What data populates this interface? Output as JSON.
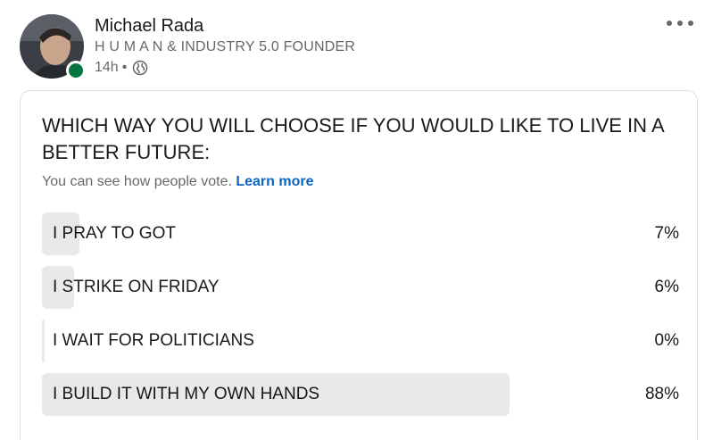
{
  "author": {
    "name": "Michael Rada",
    "headline": "H U M A N & INDUSTRY 5.0 FOUNDER",
    "time": "14h",
    "separator": "•",
    "status_color": "#057642"
  },
  "poll": {
    "question": "WHICH WAY YOU WILL CHOOSE IF YOU WOULD LIKE TO LIVE IN A BETTER FUTURE:",
    "visibility_text": "You can see how people vote.",
    "learn_more": "Learn more",
    "options": [
      {
        "label": "I PRAY TO GOT",
        "percent": "7%",
        "value": 7
      },
      {
        "label": "I STRIKE ON FRIDAY",
        "percent": "6%",
        "value": 6
      },
      {
        "label": "I WAIT FOR POLITICIANS",
        "percent": "0%",
        "value": 0
      },
      {
        "label": "I BUILD IT WITH MY OWN HANDS",
        "percent": "88%",
        "value": 88
      }
    ]
  },
  "icons": {
    "more": "more-options-icon",
    "visibility": "globe-icon",
    "presence": "online-status-indicator"
  }
}
